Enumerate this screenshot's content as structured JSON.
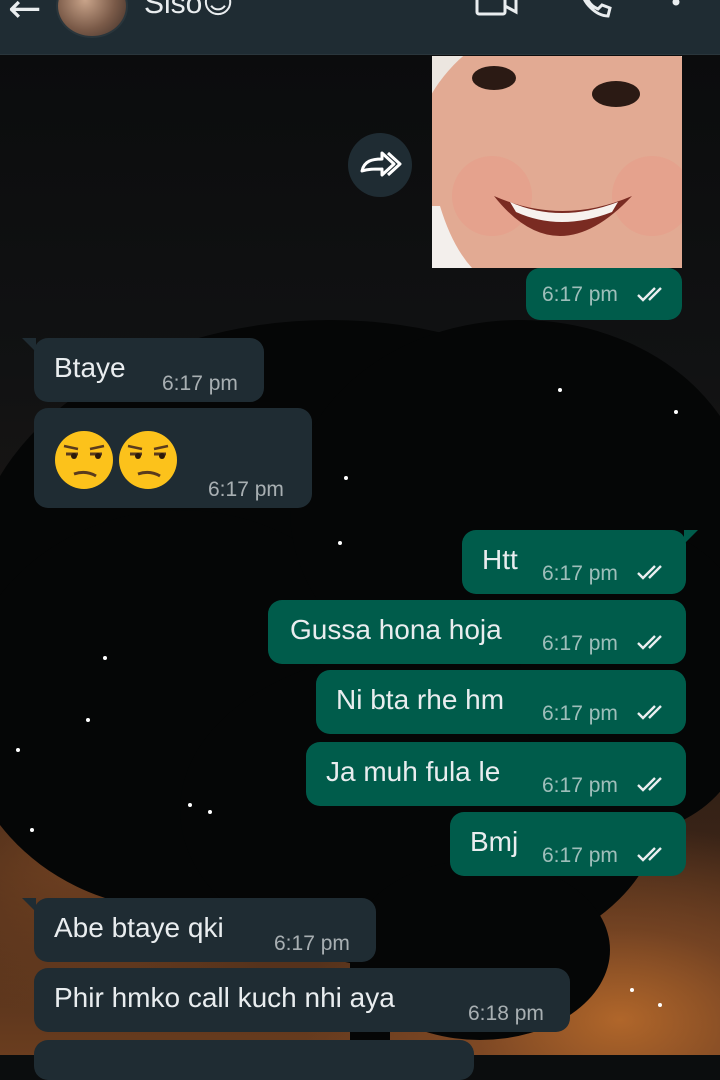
{
  "header": {
    "back_icon": "arrow-left-icon",
    "contact_name": "Siso😊",
    "video_icon": "video-call-icon",
    "call_icon": "phone-call-icon",
    "menu_icon": "more-vertical-icon"
  },
  "forward_icon": "forward-icon",
  "image_message": {
    "time": "6:17 pm",
    "status": "read"
  },
  "messages": [
    {
      "dir": "in",
      "text": "Btaye",
      "time": "6:17 pm"
    },
    {
      "dir": "in",
      "text": "😒😒",
      "time": "6:17 pm"
    },
    {
      "dir": "out",
      "text": "Htt",
      "time": "6:17 pm",
      "status": "read"
    },
    {
      "dir": "out",
      "text": "Gussa hona hoja",
      "time": "6:17 pm",
      "status": "read"
    },
    {
      "dir": "out",
      "text": "Ni bta rhe hm",
      "time": "6:17 pm",
      "status": "read"
    },
    {
      "dir": "out",
      "text": "Ja muh fula le",
      "time": "6:17 pm",
      "status": "read"
    },
    {
      "dir": "out",
      "text": "Bmj",
      "time": "6:17 pm",
      "status": "read"
    },
    {
      "dir": "in",
      "text": "Abe btaye qki",
      "time": "6:17 pm"
    },
    {
      "dir": "in",
      "text": "Phir hmko call kuch nhi aya",
      "time": "6:18 pm"
    }
  ],
  "colors": {
    "header_bg": "#1f2c33",
    "incoming_bubble": "#1f2c33",
    "outgoing_bubble": "#005c4b",
    "read_ticks": "#e9edef"
  }
}
